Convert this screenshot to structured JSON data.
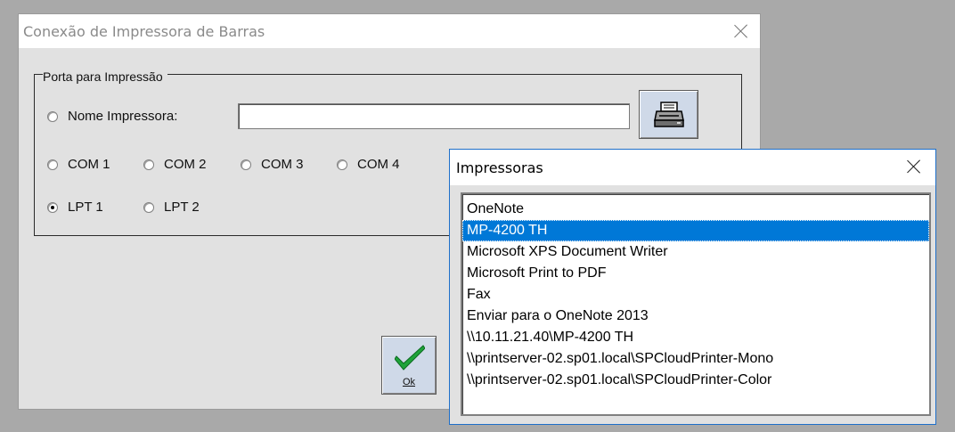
{
  "main_window": {
    "title": "Conexão de Impressora de Barras",
    "group_label": "Porta para Impressão",
    "radio_printer_name": "Nome Impressora:",
    "printer_name_value": "",
    "com_ports": [
      "COM 1",
      "COM 2",
      "COM 3",
      "COM 4"
    ],
    "lpt_ports": [
      "LPT 1",
      "LPT 2"
    ],
    "selected_port": "LPT 1",
    "ok_label": "Ok"
  },
  "printers_popup": {
    "title": "Impressoras",
    "items": [
      "OneNote",
      "MP-4200 TH",
      "Microsoft XPS Document Writer",
      "Microsoft Print to PDF",
      "Fax",
      "Enviar para o OneNote 2013",
      "\\\\10.11.21.40\\MP-4200 TH",
      "\\\\printserver-02.sp01.local\\SPCloudPrinter-Mono",
      "\\\\printserver-02.sp01.local\\SPCloudPrinter-Color"
    ],
    "selected_item": "MP-4200 TH"
  },
  "icons": {
    "print_button": "printer-icon",
    "ok_button": "checkmark-icon",
    "close": "close-icon"
  },
  "colors": {
    "selection": "#0078d7",
    "button_face": "#cfd9e8",
    "window_bg": "#e1e1e1",
    "checkmark": "#1fa33a"
  }
}
